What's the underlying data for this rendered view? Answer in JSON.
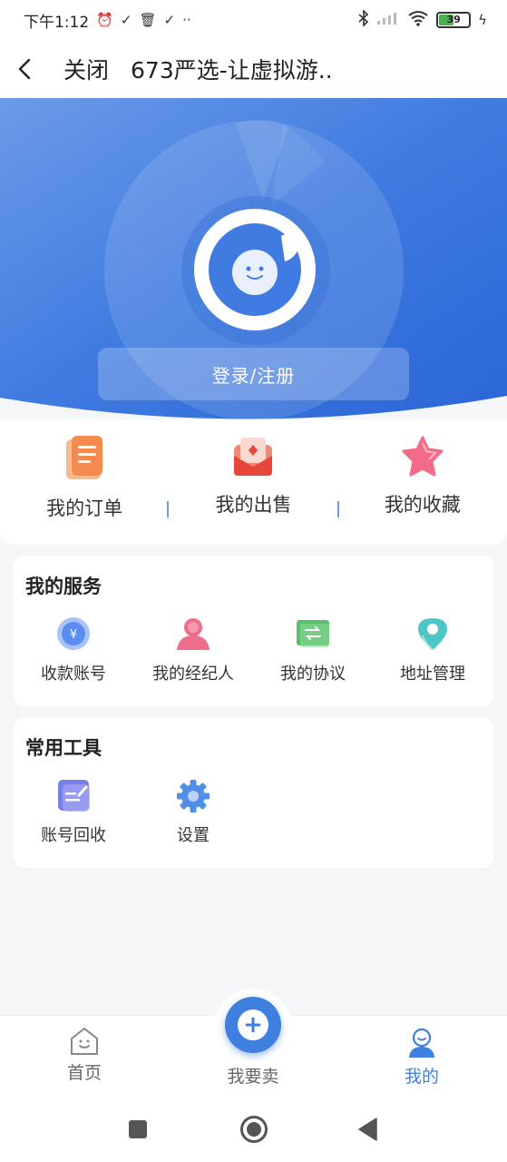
{
  "status_bar": {
    "time": "下午1:12",
    "dots": "··",
    "battery": "39"
  },
  "titlebar": {
    "close_label": "关闭",
    "title": "673严选-让虚拟游.."
  },
  "hero": {
    "login_label": "登录/注册"
  },
  "orders": [
    {
      "label": "我的订单",
      "icon": "order-doc-icon"
    },
    {
      "label": "我的出售",
      "icon": "sell-envelope-icon"
    },
    {
      "label": "我的收藏",
      "icon": "star-icon"
    }
  ],
  "services": {
    "title": "我的服务",
    "items": [
      {
        "label": "收款账号",
        "icon": "yen-coin-icon"
      },
      {
        "label": "我的经纪人",
        "icon": "person-icon"
      },
      {
        "label": "我的协议",
        "icon": "agreement-icon"
      },
      {
        "label": "地址管理",
        "icon": "location-pin-icon"
      }
    ]
  },
  "tools": {
    "title": "常用工具",
    "items": [
      {
        "label": "账号回收",
        "icon": "recycle-note-icon"
      },
      {
        "label": "设置",
        "icon": "gear-icon"
      }
    ]
  },
  "bottom_nav": {
    "home": "首页",
    "sell": "我要卖",
    "mine": "我的"
  },
  "colors": {
    "primary": "#3e7fe0",
    "active_tab": "#3e7fe0",
    "inactive_tab": "#666666"
  }
}
